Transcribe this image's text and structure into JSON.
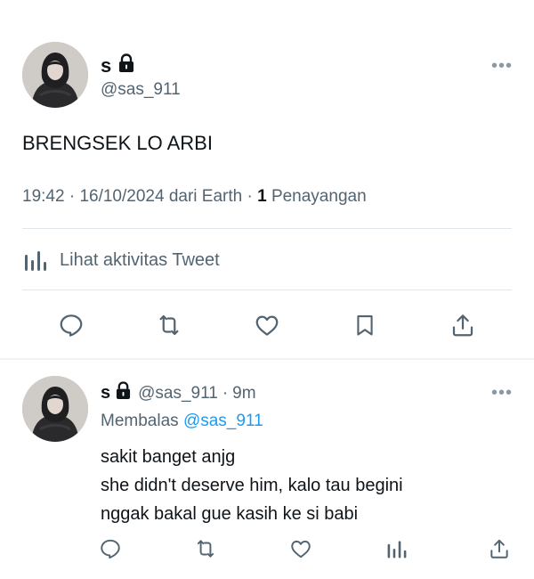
{
  "tweet": {
    "display_name": "s",
    "handle": "@sas_911",
    "text": "BRENGSEK LO ARBI",
    "time": "19:42",
    "sep1": "·",
    "date": "16/10/2024",
    "source": "dari Earth",
    "sep2": "·",
    "views_count": "1",
    "views_label": "Penayangan",
    "activity_label": "Lihat aktivitas Tweet",
    "more": "•••"
  },
  "reply": {
    "display_name": "s",
    "handle": "@sas_911",
    "sep": "·",
    "time": "9m",
    "replying_label": "Membalas",
    "replying_to": "@sas_911",
    "lines": [
      "sakit banget anjg",
      "she didn't deserve him, kalo tau begini",
      "nggak bakal gue kasih ke si babi"
    ],
    "more": "•••"
  },
  "icons": {
    "reply": "reply-icon",
    "retweet": "retweet-icon",
    "like": "heart-icon",
    "bookmark": "bookmark-icon",
    "share": "share-icon",
    "analytics": "analytics-icon",
    "lock": "lock-icon"
  },
  "colors": {
    "text": "#0f1419",
    "secondary": "#536471",
    "link": "#1d9bf0",
    "divider": "#e1e6ea"
  }
}
